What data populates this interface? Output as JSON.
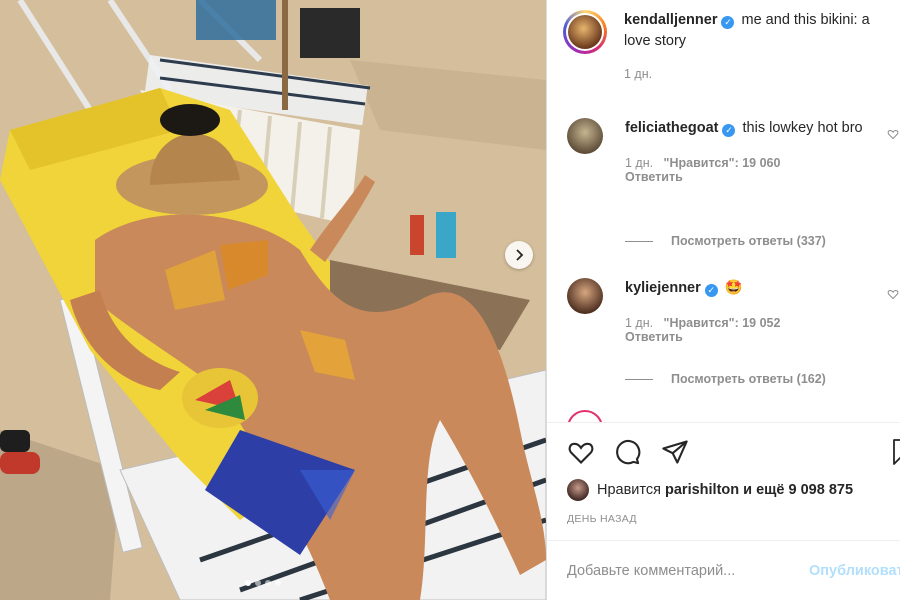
{
  "post": {
    "author": "kendalljenner",
    "caption": "me and this bikini: a love story",
    "time": "1 дн.",
    "verified_glyph": "✓"
  },
  "comments": [
    {
      "user": "feliciathegoat",
      "text": "this lowkey hot bro",
      "time": "1 дн.",
      "likes": "\"Нравится\": 19 060",
      "reply": "Ответить",
      "view_replies": "Посмотреть ответы (337)",
      "avatar_color": "#8a7a62"
    },
    {
      "user": "kyliejenner",
      "text": "🤩",
      "time": "1 дн.",
      "likes": "\"Нравится\": 19 052",
      "reply": "Ответить",
      "view_replies": "Посмотреть ответы (162)",
      "avatar_color": "#b88a6a"
    }
  ],
  "likes": {
    "prefix": "Нравится",
    "user": "parishilton",
    "suffix": "и ещё 9 098 875"
  },
  "date_label": "ДЕНЬ НАЗАД",
  "comment_box": {
    "placeholder": "Добавьте комментарий...",
    "publish_label": "Опубликовать"
  },
  "carousel": {
    "slides": 4,
    "active": 1
  },
  "colors": {
    "accent": "#3897f0",
    "publish_disabled": "#b2dffc",
    "muted_text": "#8e8e8e"
  },
  "icons": [
    "heart-icon",
    "comment-icon",
    "share-icon",
    "bookmark-icon",
    "chevron-right-icon",
    "verified-icon"
  ]
}
